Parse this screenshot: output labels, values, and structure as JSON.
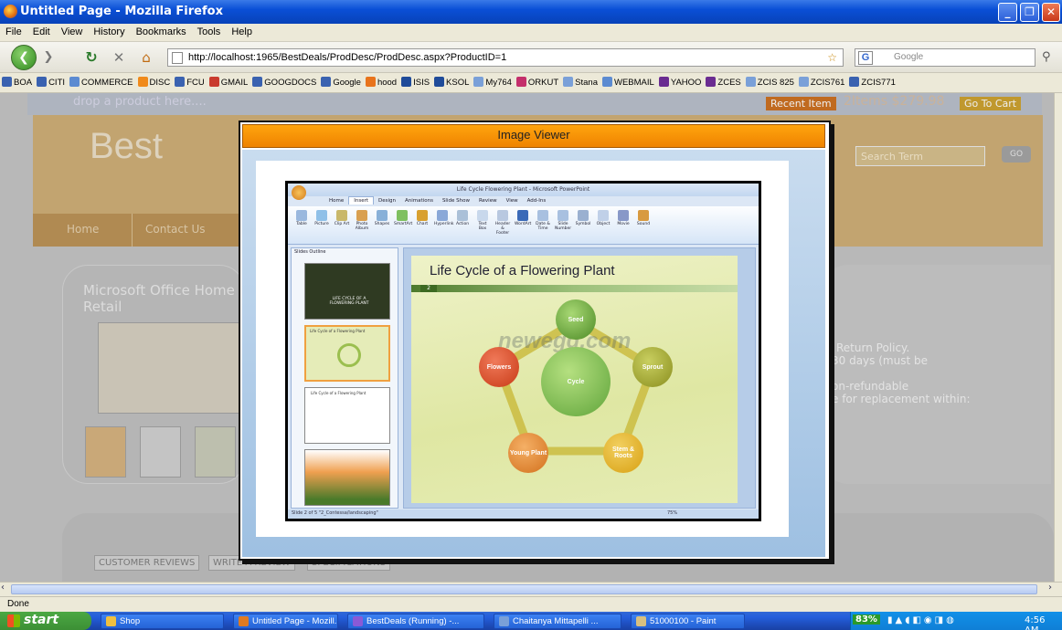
{
  "window": {
    "title": "Untitled Page - Mozilla Firefox"
  },
  "menu": [
    "File",
    "Edit",
    "View",
    "History",
    "Bookmarks",
    "Tools",
    "Help"
  ],
  "nav": {
    "url": "http://localhost:1965/BestDeals/ProdDesc/ProdDesc.aspx?ProductID=1",
    "search_placeholder": "Google"
  },
  "bookmarks": [
    {
      "label": "BOA",
      "color": "#3a62b0"
    },
    {
      "label": "CITI",
      "color": "#3a62b0"
    },
    {
      "label": "COMMERCE",
      "color": "#5c8bd1"
    },
    {
      "label": "DISC",
      "color": "#f08a1a"
    },
    {
      "label": "FCU",
      "color": "#3a62b0"
    },
    {
      "label": "GMAIL",
      "color": "#c93b2e"
    },
    {
      "label": "GOOGDOCS",
      "color": "#3a62b0"
    },
    {
      "label": "Google",
      "color": "#3a62b0"
    },
    {
      "label": "hood",
      "color": "#e8731b"
    },
    {
      "label": "ISIS",
      "color": "#1f4b99"
    },
    {
      "label": "KSOL",
      "color": "#1f4b99"
    },
    {
      "label": "My764",
      "color": "#7aa0d8"
    },
    {
      "label": "ORKUT",
      "color": "#c42f6b"
    },
    {
      "label": "Stana",
      "color": "#7aa0d8"
    },
    {
      "label": "WEBMAIL",
      "color": "#5c8bd1"
    },
    {
      "label": "YAHOO",
      "color": "#6a2c91"
    },
    {
      "label": "ZCES",
      "color": "#6a2c91"
    },
    {
      "label": "ZCIS 825",
      "color": "#7aa0d8"
    },
    {
      "label": "ZCIS761",
      "color": "#7aa0d8"
    },
    {
      "label": "ZCIS771",
      "color": "#3a62b0"
    }
  ],
  "page": {
    "drop_hint": "drop a product here....",
    "recent_item": "Recent Item",
    "cart_summary": "2Items $279.98",
    "go_to_cart": "Go To Cart",
    "brand": "Best",
    "search_term": "Search Term",
    "go": "GO",
    "nav_home": "Home",
    "nav_contact": "Contact Us",
    "product_title": "Microsoft Office Home",
    "product_title_2": "Retail",
    "policy_1": "Return Policy.",
    "policy_2": "30 days (must be",
    "policy_3": "on-refundable",
    "policy_4": "e for replacement within:",
    "tab_reviews": "CUSTOMER REVIEWS",
    "tab_write": "WRITE A REVIEW",
    "tab_specs": "SPECIFICATIONS"
  },
  "modal": {
    "title": "Image Viewer",
    "ppt": {
      "window_title": "Life Cycle Flowering Plant - Microsoft PowerPoint",
      "tabs": [
        "Home",
        "Insert",
        "Design",
        "Animations",
        "Slide Show",
        "Review",
        "View",
        "Add-Ins"
      ],
      "ribbon": [
        "Table",
        "Picture",
        "Clip Art",
        "Photo Album",
        "Shapes",
        "SmartArt",
        "Chart",
        "Hyperlink",
        "Action",
        "Text Box",
        "Header & Footer",
        "WordArt",
        "Date & Time",
        "Slide Number",
        "Symbol",
        "Object",
        "Movie",
        "Sound"
      ],
      "panel_tabs": "Slides  Outline",
      "thumb1_text": "LIFE CYCLE OF A FLOWERING PLANT",
      "thumb2_text": "Life Cycle of a Flowering Plant",
      "thumb3_text": "Life Cycle of a Flowering Plant",
      "slide_title": "Life Cycle of a Flowering Plant",
      "slide_number": "2",
      "watermark": "newegg.com",
      "nodes": {
        "center": "Cycle",
        "seed": "Seed",
        "sprout": "Sprout",
        "stem": "Stem & Roots",
        "young": "Young Plant",
        "flowers": "Flowers"
      },
      "status": "Slide 2 of 5   \"2_Contessa/landscaping\"",
      "zoom": "75%"
    }
  },
  "status": "Done",
  "taskbar": {
    "start": "start",
    "tasks": [
      {
        "label": "Shop",
        "color": "#f0c040"
      },
      {
        "label": "Untitled Page - Mozill...",
        "color": "#e07a20"
      },
      {
        "label": "BestDeals (Running) -...",
        "color": "#8a5ad6"
      },
      {
        "label": "Chaitanya Mittapelli ...",
        "color": "#7aa0d8"
      },
      {
        "label": "51000100 - Paint",
        "color": "#d8c080"
      }
    ],
    "battery": "83%",
    "clock": "4:56 AM"
  }
}
